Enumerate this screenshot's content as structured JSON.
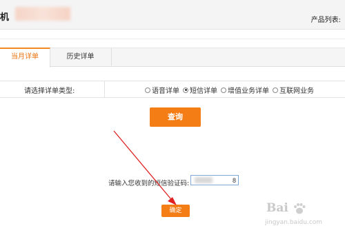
{
  "header": {
    "title": "机",
    "products_label": "产品列表:"
  },
  "tabs": [
    {
      "label": "当月详单",
      "active": true
    },
    {
      "label": "历史详单",
      "active": false
    }
  ],
  "detail_type": {
    "label": "请选择详单类型:",
    "options": [
      {
        "label": "语音详单",
        "checked": false
      },
      {
        "label": "短信详单",
        "checked": true
      },
      {
        "label": "增值业务详单",
        "checked": false
      },
      {
        "label": "互联网业务",
        "checked": false
      }
    ]
  },
  "query_button": "查询",
  "verification": {
    "label": "请输入您收到的短信验证码:",
    "value": "8"
  },
  "confirm_button": "确定",
  "watermark": {
    "brand": "Bai",
    "url": "jingyan.baidu.com"
  },
  "colors": {
    "accent": "#f47d16",
    "active_tab_text": "#e8730f",
    "annotation_arrow": "#e02020"
  }
}
